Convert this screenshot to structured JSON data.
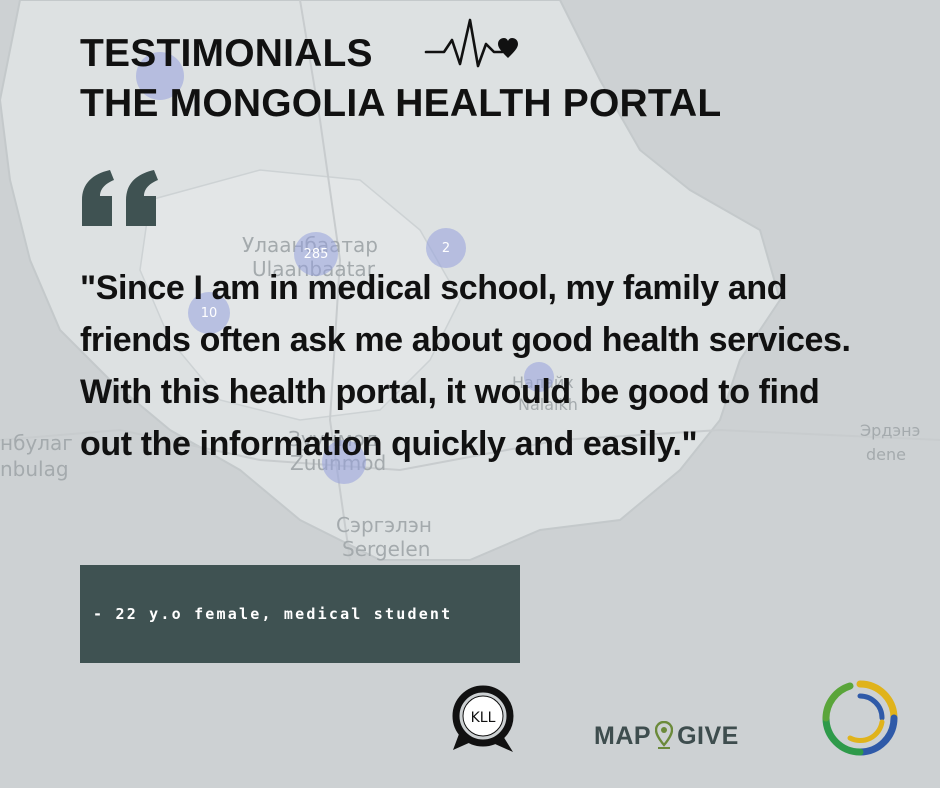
{
  "header": {
    "title_line1": "TESTIMONIALS",
    "title_line2": "THE MONGOLIA HEALTH PORTAL",
    "pulse_icon": "heartbeat-heart-icon"
  },
  "map": {
    "labels": {
      "city_mn": "Улаанбаатар",
      "city_en": "Ulaanbaatar",
      "sergelen_mn": "Сэргэлэн",
      "sergelen_en": "Sergelen",
      "west_mn": "нбулаг",
      "west_en": "nbulag",
      "east_mn": "Эрдэнэ",
      "east_en": "dene",
      "zuun_mn": "Зуунмод",
      "zuun_en": "Zuunmod",
      "nalaikh_mn": "Налайх",
      "nalaikh_en": "Nalaikh"
    },
    "clusters": {
      "c285": "285",
      "c2": "2",
      "c10": "10"
    }
  },
  "quote": {
    "icon": "quote-mark-icon",
    "text": "\"Since I am in medical school, my family and friends often ask me about good health services. With this health portal, it would be good to find out the information quickly and easily.\""
  },
  "author": {
    "label": "- 22 y.o female, medical student"
  },
  "logos": {
    "kll_text": "KLL",
    "mapgive_left": "MAP",
    "mapgive_right": "GIVE",
    "ring_icon": "ring-logo-icon"
  },
  "colors": {
    "accent": "#3f5252",
    "text": "#111111",
    "background": "#cdd1d3"
  }
}
